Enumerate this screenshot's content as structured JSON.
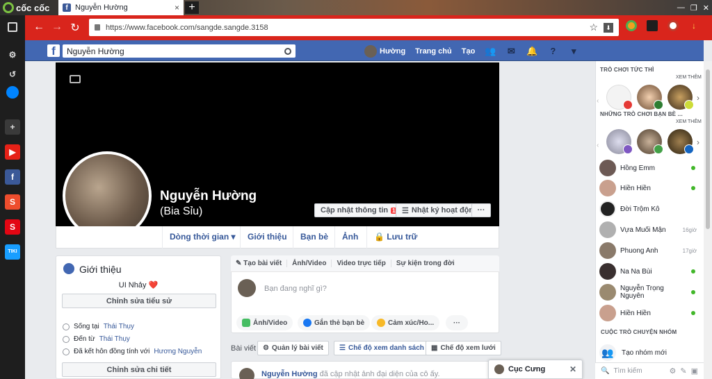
{
  "browser": {
    "brand": "cốc cốc",
    "tab_title": "Nguyễn Hường",
    "tab_close": "×",
    "new_tab": "+",
    "url": "https://www.facebook.com/sangde.sangde.3158",
    "window_controls": [
      "—",
      "❐",
      "✕"
    ]
  },
  "fb_header": {
    "search_value": "Nguyễn Hường",
    "profile_name": "Hường",
    "home": "Trang chủ",
    "create": "Tạo"
  },
  "profile": {
    "name": "Nguyễn Hường",
    "alt_name": "(Bia Sỉu)",
    "update_info": "Cập nhật thông tin",
    "update_badge": "1",
    "activity_log": "Nhật ký hoạt động",
    "more": "···"
  },
  "tabs": [
    "Dòng thời gian ▾",
    "Giới thiệu",
    "Bạn bè",
    "Ảnh",
    "Lưu trữ"
  ],
  "intro": {
    "title": "Giới thiệu",
    "bio": "UI Nhảy ❤️",
    "edit_bio": "Chỉnh sửa tiểu sử",
    "lives_prefix": "Sống tại",
    "lives_place": "Thái Thụy",
    "from_prefix": "Đến từ",
    "from_place": "Thái Thụy",
    "married_prefix": "Đã kết hôn đồng tính với",
    "married_to": "Hương Nguyễn",
    "edit_details": "Chỉnh sửa chi tiết"
  },
  "composer": {
    "tabs": [
      "✎ Tạo bài viết",
      "Ảnh/Video",
      "Video trực tiếp",
      "Sự kiện trong đời"
    ],
    "placeholder": "Bạn đang nghĩ gì?",
    "actions": [
      "Ảnh/Video",
      "Gắn thẻ bạn bè",
      "Cảm xúc/Ho..."
    ],
    "more": "···"
  },
  "posts": {
    "label": "Bài viết",
    "manage": "Quản lý bài viết",
    "list_view": "Chế độ xem danh sách",
    "grid_view": "Chế độ xem lưới",
    "first_author": "Nguyễn Hường",
    "first_text": "đã cập nhật ảnh đại diện của cô ấy."
  },
  "chat_popup": {
    "name": "Cục Cưng",
    "close": "✕"
  },
  "right": {
    "games_title": "TRÒ CHƠI TỨC THÌ",
    "see_more": "XEM THÊM",
    "friends_games_title": "NHỮNG TRÒ CHƠI BẠN BÈ ...",
    "see_more2": "XEM THÊM",
    "friends": [
      {
        "name": "Hồng Emm",
        "status": ""
      },
      {
        "name": "Hiền Hiền",
        "status": ""
      },
      {
        "name": "Đời Trộm Kô",
        "status": ""
      },
      {
        "name": "Vựa Muối Mận",
        "status": "16giờ"
      },
      {
        "name": "Phuong Anh",
        "status": "17giờ"
      },
      {
        "name": "Na Na Bùi",
        "status": ""
      },
      {
        "name": "Nguyễn Trọng Nguyên",
        "status": ""
      },
      {
        "name": "Hiền Hiền",
        "status": ""
      }
    ],
    "groups_title": "CUỘC TRÒ CHUYỆN NHÓM",
    "new_group": "Tạo nhóm mới",
    "search_placeholder": "Tìm kiếm"
  },
  "colors": {
    "fb_blue": "#4267b2",
    "browser_red": "#d9251c",
    "online": "#42b72a"
  }
}
